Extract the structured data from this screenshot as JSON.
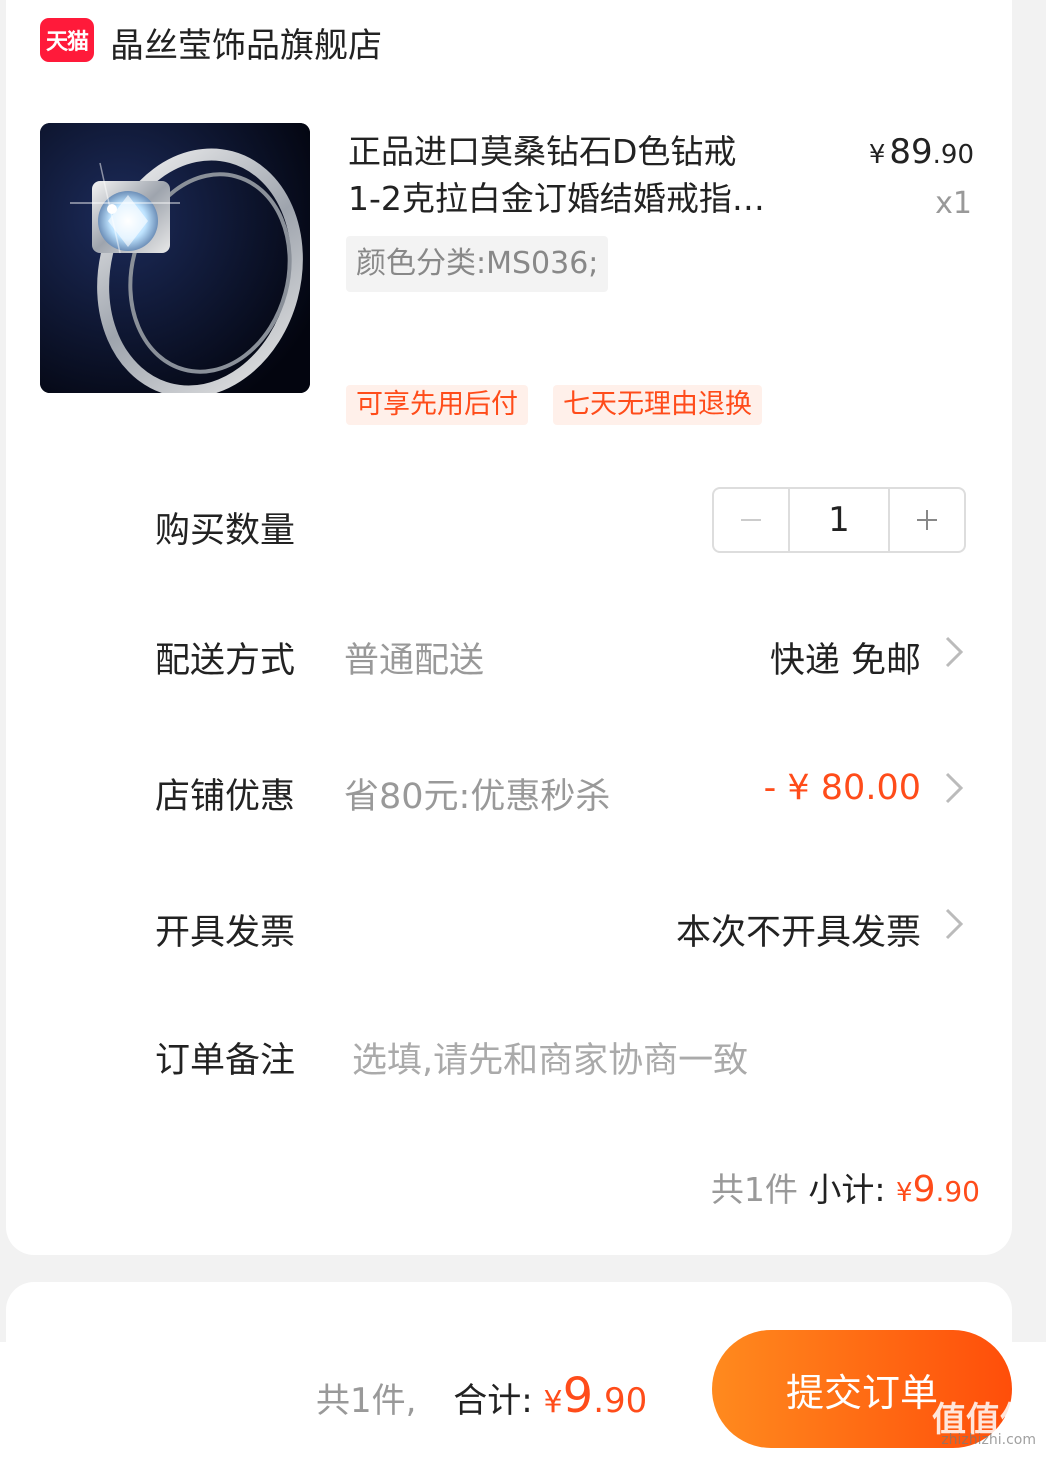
{
  "shop": {
    "badge": "天猫",
    "name": "晶丝莹饰品旗舰店"
  },
  "product": {
    "title": "正品进口莫桑钻石D色钻戒\n1-2克拉白金订婚结婚戒指…",
    "price_currency": "¥",
    "price_int": "89",
    "price_dec": ".90",
    "quantity_label": "x1",
    "sku": "颜色分类:MS036;",
    "tags": [
      "可享先用后付",
      "七天无理由退换"
    ]
  },
  "rows": {
    "quantity": {
      "label": "购买数量",
      "value": "1"
    },
    "delivery": {
      "label": "配送方式",
      "sub": "普通配送",
      "value": "快递 免邮"
    },
    "discount": {
      "label": "店铺优惠",
      "sub": "省80元:优惠秒杀",
      "value": "- ¥ 80.00"
    },
    "invoice": {
      "label": "开具发票",
      "value": "本次不开具发票"
    },
    "note": {
      "label": "订单备注",
      "placeholder": "选填,请先和商家协商一致"
    }
  },
  "subtotal": {
    "count": "共1件",
    "label": "小计:",
    "currency": "¥",
    "int": "9",
    "dec": ".90"
  },
  "footer": {
    "count": "共1件,",
    "label": "合计:",
    "currency": "¥",
    "int": "9",
    "dec": ".90",
    "submit": "提交订单",
    "watermark": "值值值",
    "watermark_url": "zhizhizhi.com"
  },
  "colors": {
    "accent": "#ff4c1a",
    "tmall_red": "#ff1a3a"
  }
}
